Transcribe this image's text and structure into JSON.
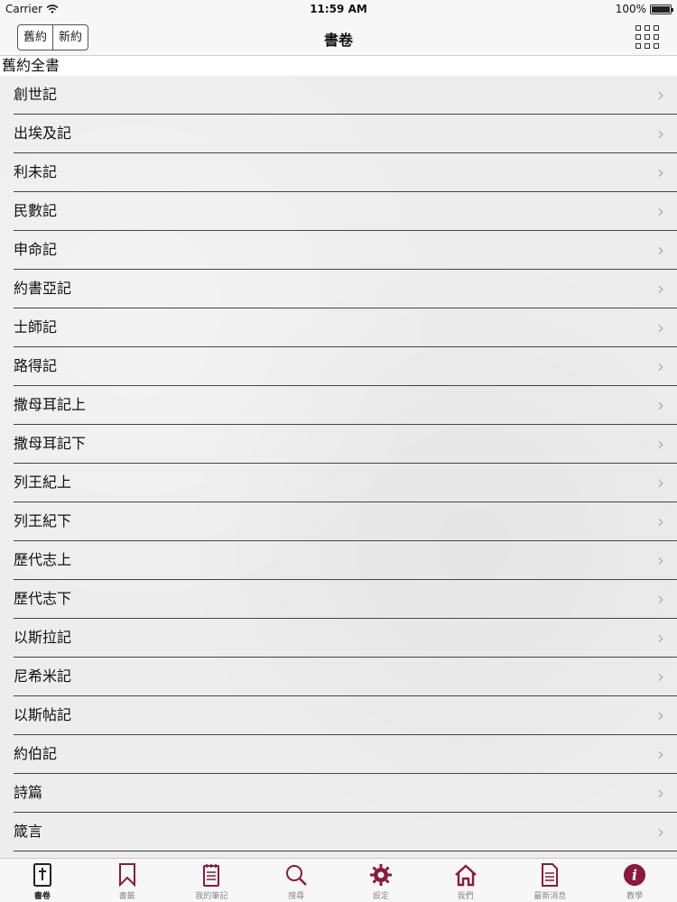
{
  "status_bar": {
    "carrier": "Carrier",
    "time": "11:59 AM",
    "battery": "100%"
  },
  "nav": {
    "segments": [
      "舊約",
      "新約"
    ],
    "title": "書卷"
  },
  "section": {
    "title": "舊約全書"
  },
  "books": [
    "創世記",
    "出埃及記",
    "利未記",
    "民數記",
    "申命記",
    "約書亞記",
    "士師記",
    "路得記",
    "撒母耳記上",
    "撒母耳記下",
    "列王紀上",
    "列王紀下",
    "歷代志上",
    "歷代志下",
    "以斯拉記",
    "尼希米記",
    "以斯帖記",
    "約伯記",
    "詩篇",
    "箴言"
  ],
  "tabs": [
    {
      "label": "書卷",
      "icon": "bible-icon"
    },
    {
      "label": "書籤",
      "icon": "bookmark-icon"
    },
    {
      "label": "我的筆記",
      "icon": "notepad-icon"
    },
    {
      "label": "搜尋",
      "icon": "search-icon"
    },
    {
      "label": "設定",
      "icon": "gear-icon"
    },
    {
      "label": "我們",
      "icon": "home-icon"
    },
    {
      "label": "最新消息",
      "icon": "document-icon"
    },
    {
      "label": "教學",
      "icon": "info-icon"
    }
  ],
  "colors": {
    "accent": "#8b1a3a"
  }
}
